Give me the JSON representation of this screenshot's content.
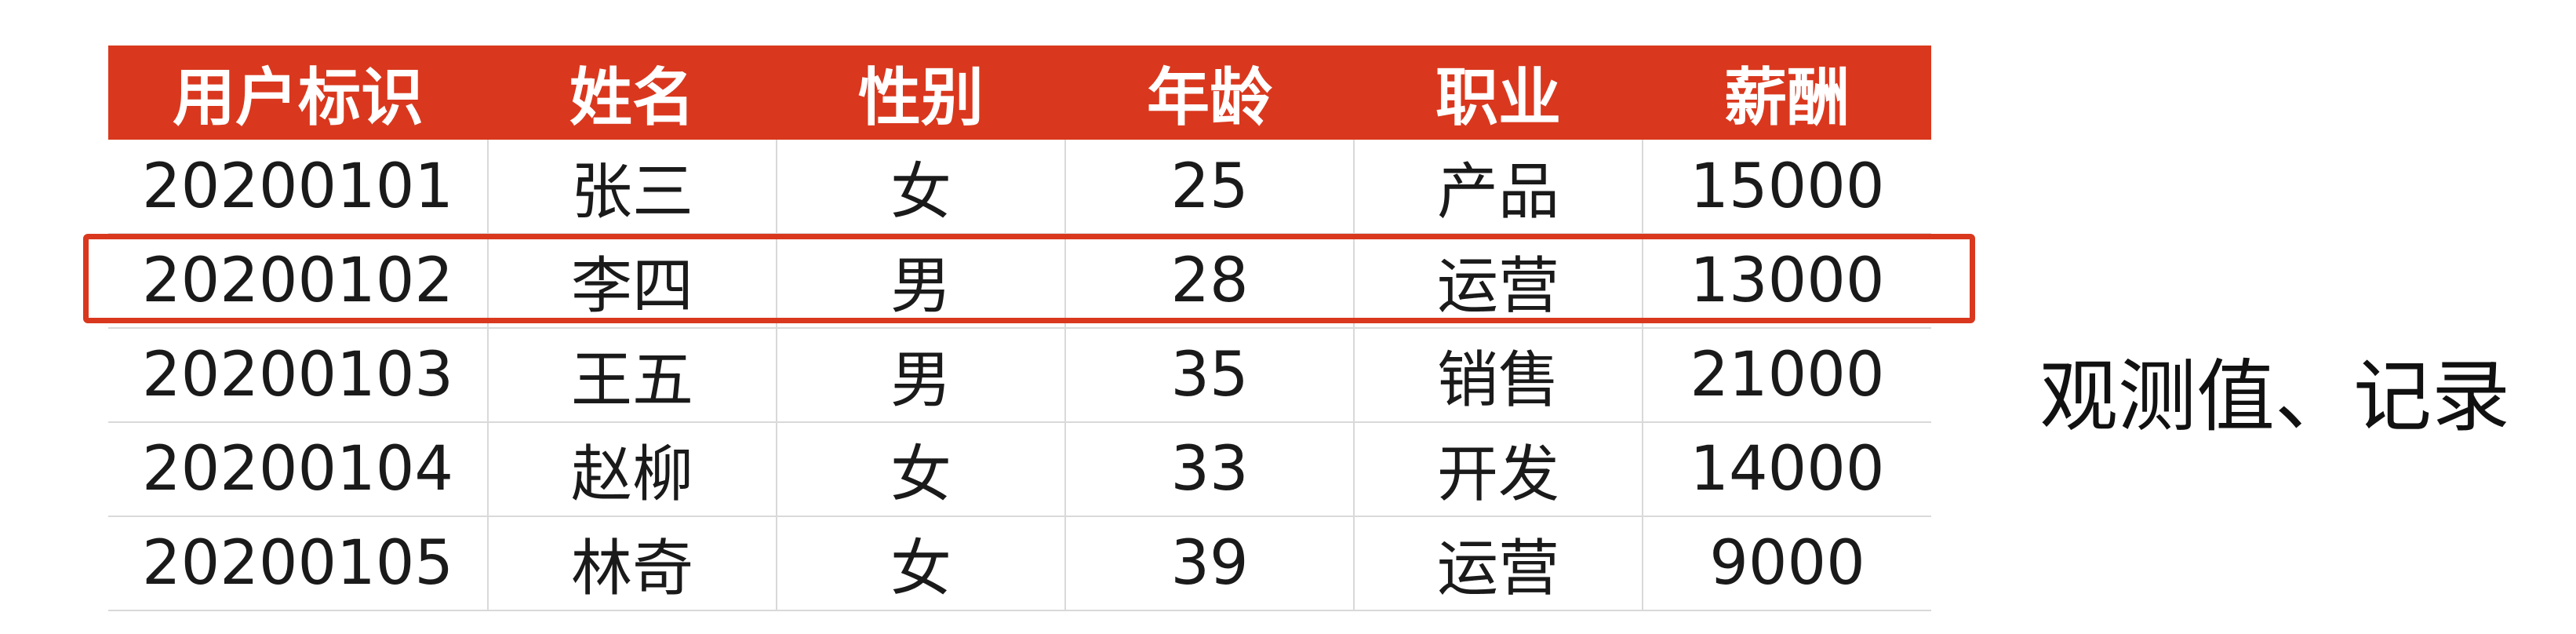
{
  "table": {
    "headers": [
      "用户标识",
      "姓名",
      "性别",
      "年龄",
      "职业",
      "薪酬"
    ],
    "rows": [
      [
        "20200101",
        "张三",
        "女",
        "25",
        "产品",
        "15000"
      ],
      [
        "20200102",
        "李四",
        "男",
        "28",
        "运营",
        "13000"
      ],
      [
        "20200103",
        "王五",
        "男",
        "35",
        "销售",
        "21000"
      ],
      [
        "20200104",
        "赵柳",
        "女",
        "33",
        "开发",
        "14000"
      ],
      [
        "20200105",
        "林奇",
        "女",
        "39",
        "运营",
        "9000"
      ]
    ],
    "highlighted_row_index": 1
  },
  "annotation": {
    "label": "观测值、记录"
  },
  "colors": {
    "header_background": "#d9381e",
    "header_text": "#ffffff",
    "highlight_border": "#d9381e",
    "grid_line": "#d9d9d9"
  }
}
